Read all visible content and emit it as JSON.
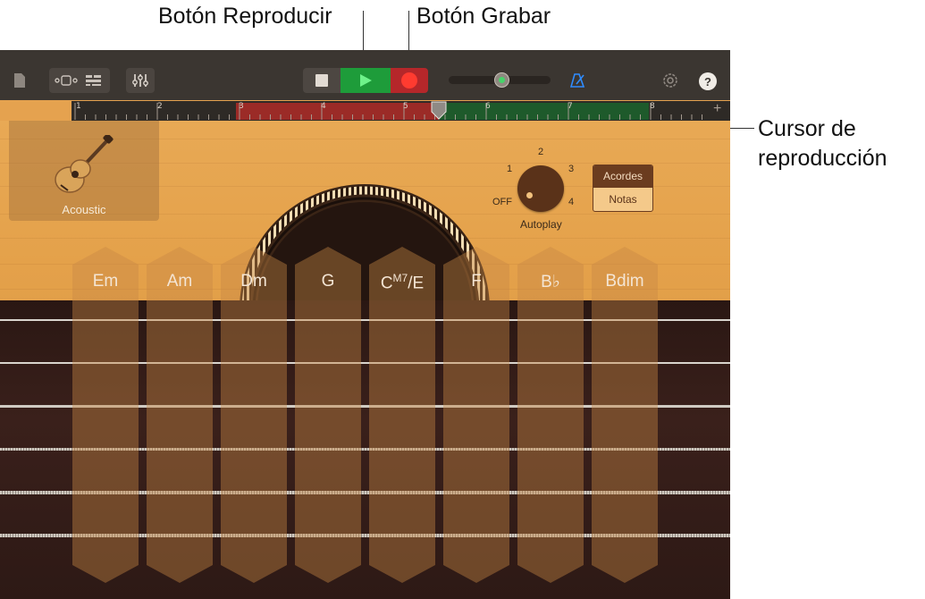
{
  "callouts": {
    "play": "Botón Reproducir",
    "record": "Botón Grabar",
    "playhead_line1": "Cursor de",
    "playhead_line2": "reproducción"
  },
  "toolbar": {
    "icons": [
      "document-icon",
      "view-toggle-icon",
      "tracks-icon",
      "mixer-icon",
      "stop-icon",
      "play-icon",
      "record-icon",
      "master-volume-slider",
      "metronome-icon",
      "settings-icon",
      "help-icon"
    ],
    "help_label": "?",
    "colors": {
      "toolbar": "#3b3631",
      "play": "#1e9c3a",
      "record": "#d8232a"
    }
  },
  "ruler": {
    "markers": [
      "1",
      "2",
      "3",
      "4",
      "5",
      "6",
      "7",
      "8"
    ],
    "add_label": "+",
    "colors": {
      "red_region": "#9b2b27",
      "green_region": "#1e5a2b"
    }
  },
  "instrument": {
    "name": "Acoustic"
  },
  "autoplay": {
    "label": "Autoplay",
    "off": "OFF",
    "positions": [
      "1",
      "2",
      "3",
      "4"
    ]
  },
  "mode_toggle": {
    "chords": "Acordes",
    "notes": "Notas",
    "selected": "Acordes"
  },
  "chords": [
    {
      "label": "Em"
    },
    {
      "label": "Am"
    },
    {
      "label": "Dm"
    },
    {
      "label": "G"
    },
    {
      "label": "C",
      "sup": "M7",
      "suffix": "/E"
    },
    {
      "label": "F"
    },
    {
      "label": "B♭"
    },
    {
      "label": "Bdim"
    }
  ]
}
